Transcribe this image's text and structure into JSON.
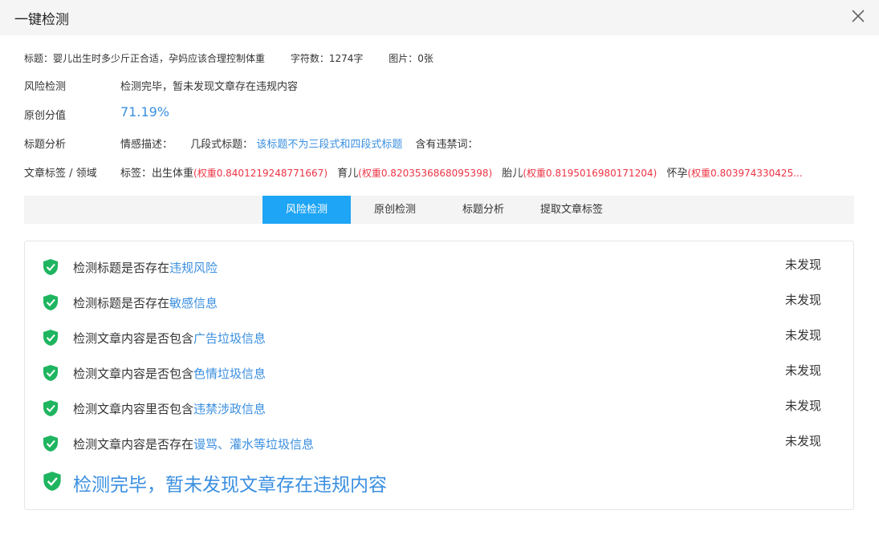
{
  "header": {
    "title": "一键检测"
  },
  "meta": {
    "title_text": "标题：婴儿出生时多少斤正合适，孕妈应该合理控制体重",
    "word_count": "字符数：1274字",
    "images": "图片：0张"
  },
  "risk": {
    "label": "风险检测",
    "value": "检测完毕，暂未发现文章存在违规内容"
  },
  "originality": {
    "label": "原创分值",
    "value": "71.19%"
  },
  "title_analysis": {
    "label": "标题分析",
    "emotion": "情感描述：",
    "segment_label": "几段式标题：",
    "segment_value": "该标题不为三段式和四段式标题",
    "banned_label": "含有违禁词："
  },
  "tags": {
    "label": "文章标签 / 领域",
    "prefix": "标签：",
    "items": [
      {
        "name": "出生体重",
        "weight": "(权重0.8401219248771667)"
      },
      {
        "name": "育儿",
        "weight": "(权重0.8203536868095398)"
      },
      {
        "name": "胎儿",
        "weight": "(权重0.8195016980171204)"
      },
      {
        "name": "怀孕",
        "weight": "(权重0.803974330425..."
      }
    ]
  },
  "tabs": [
    "风险检测",
    "原创检测",
    "标题分析",
    "提取文章标签"
  ],
  "checks": [
    {
      "prefix": "检测标题是否存在",
      "highlight": "违规风险",
      "status": "未发现"
    },
    {
      "prefix": "检测标题是否存在",
      "highlight": "敏感信息",
      "status": "未发现"
    },
    {
      "prefix": "检测文章内容是否包含",
      "highlight": "广告垃圾信息",
      "status": "未发现"
    },
    {
      "prefix": "检测文章内容是否包含",
      "highlight": "色情垃圾信息",
      "status": "未发现"
    },
    {
      "prefix": "检测文章内容里否包含",
      "highlight": "违禁涉政信息",
      "status": "未发现"
    },
    {
      "prefix": "检测文章内容是否存在",
      "highlight": "谩骂、灌水等垃圾信息",
      "status": "未发现"
    }
  ],
  "final_message": "检测完毕，暂未发现文章存在违规内容",
  "colors": {
    "accent": "#1ea5f5",
    "link": "#3b8fe0",
    "weight": "#ee3344",
    "shield": "#1fb560"
  }
}
